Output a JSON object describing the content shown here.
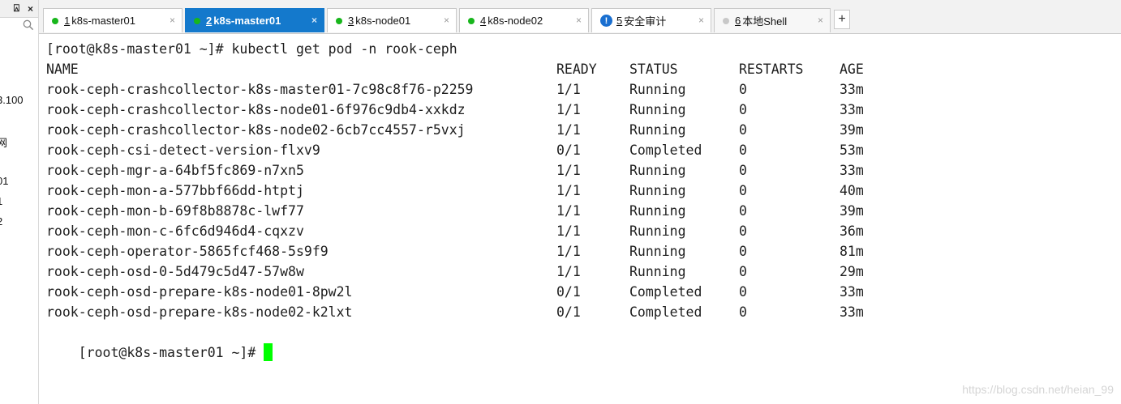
{
  "sidebar": {
    "pin_label": "p",
    "close_label": "×",
    "search_icon": "search-icon",
    "items": [
      "3.100",
      "·",
      "网",
      "01",
      "1",
      "2",
      "·"
    ]
  },
  "tabs": [
    {
      "number": "1",
      "label": "k8s-master01",
      "status": "connected",
      "active": false
    },
    {
      "number": "2",
      "label": "k8s-master01",
      "status": "connected",
      "active": true
    },
    {
      "number": "3",
      "label": "k8s-node01",
      "status": "connected",
      "active": false
    },
    {
      "number": "4",
      "label": "k8s-node02",
      "status": "connected",
      "active": false
    },
    {
      "number": "5",
      "label": "安全审计",
      "status": "info",
      "active": false
    },
    {
      "number": "6",
      "label": "本地Shell",
      "status": "disconnected",
      "active": false
    }
  ],
  "tab_close": "×",
  "add_tab_label": "+",
  "terminal": {
    "command_line": "[root@k8s-master01 ~]# kubectl get pod -n rook-ceph",
    "headers": [
      "NAME",
      "READY",
      "STATUS",
      "RESTARTS",
      "AGE"
    ],
    "rows": [
      [
        "rook-ceph-crashcollector-k8s-master01-7c98c8f76-p2259",
        "1/1",
        "Running",
        "0",
        "33m"
      ],
      [
        "rook-ceph-crashcollector-k8s-node01-6f976c9db4-xxkdz",
        "1/1",
        "Running",
        "0",
        "33m"
      ],
      [
        "rook-ceph-crashcollector-k8s-node02-6cb7cc4557-r5vxj",
        "1/1",
        "Running",
        "0",
        "39m"
      ],
      [
        "rook-ceph-csi-detect-version-flxv9",
        "0/1",
        "Completed",
        "0",
        "53m"
      ],
      [
        "rook-ceph-mgr-a-64bf5fc869-n7xn5",
        "1/1",
        "Running",
        "0",
        "33m"
      ],
      [
        "rook-ceph-mon-a-577bbf66dd-htptj",
        "1/1",
        "Running",
        "0",
        "40m"
      ],
      [
        "rook-ceph-mon-b-69f8b8878c-lwf77",
        "1/1",
        "Running",
        "0",
        "39m"
      ],
      [
        "rook-ceph-mon-c-6fc6d946d4-cqxzv",
        "1/1",
        "Running",
        "0",
        "36m"
      ],
      [
        "rook-ceph-operator-5865fcf468-5s9f9",
        "1/1",
        "Running",
        "0",
        "81m"
      ],
      [
        "rook-ceph-osd-0-5d479c5d47-57w8w",
        "1/1",
        "Running",
        "0",
        "29m"
      ],
      [
        "rook-ceph-osd-prepare-k8s-node01-8pw2l",
        "0/1",
        "Completed",
        "0",
        "33m"
      ],
      [
        "rook-ceph-osd-prepare-k8s-node02-k2lxt",
        "0/1",
        "Completed",
        "0",
        "33m"
      ]
    ],
    "prompt": "[root@k8s-master01 ~]# ",
    "cursor_color": "#00ff00"
  },
  "watermark": "https://blog.csdn.net/heian_99"
}
